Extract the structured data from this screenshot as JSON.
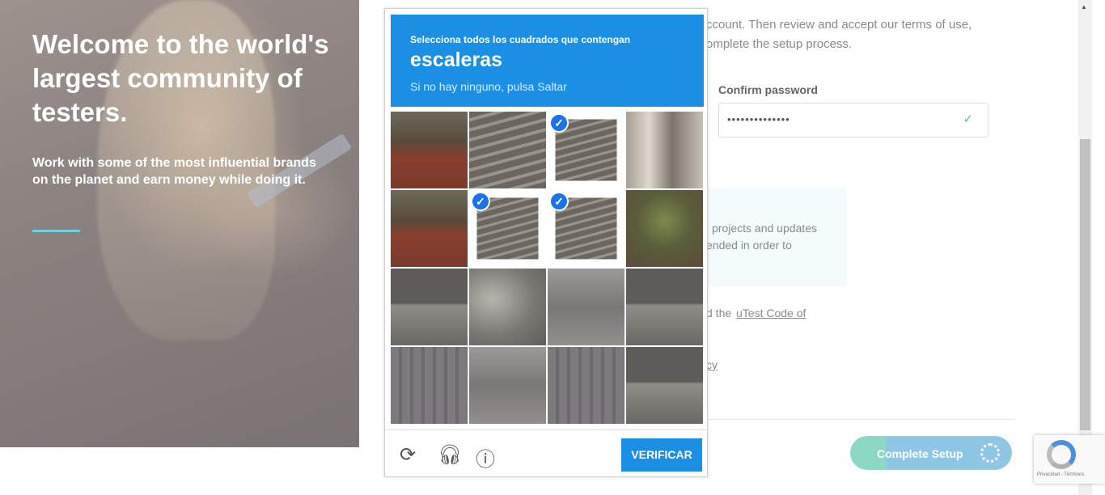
{
  "hero": {
    "title": "Welcome to the world's largest community of testers.",
    "subtitle": "Work with some of the most influential brands on the planet and earn money while doing it."
  },
  "form": {
    "intro_line1": "ccount. Then review and accept our terms of use,",
    "intro_line2": "omplete the setup process.",
    "confirm_password_label": "Confirm password",
    "confirm_password_value": "••••••••••••••",
    "info_line1": "projects and updates",
    "info_line2": "ended in order to",
    "terms_prefix": "d the ",
    "terms_link": "uTest Code of",
    "privacy_link": "cy",
    "complete_button": "Complete Setup"
  },
  "captcha": {
    "prompt": "Selecciona todos los cuadrados que contengan",
    "target": "escaleras",
    "hint": "Si no hay ninguno, pulsa Saltar",
    "verify_button": "VERIFICAR",
    "icons": [
      "reload-icon",
      "audio-icon",
      "info-icon"
    ],
    "selected_tiles": [
      2,
      5,
      6
    ]
  },
  "recaptcha_badge": {
    "terms": "Privacidad - Términos"
  },
  "colors": {
    "captcha_blue": "#1a8fe3",
    "accent_cyan": "#6fd0e2",
    "check_green": "#4fc3a1"
  }
}
